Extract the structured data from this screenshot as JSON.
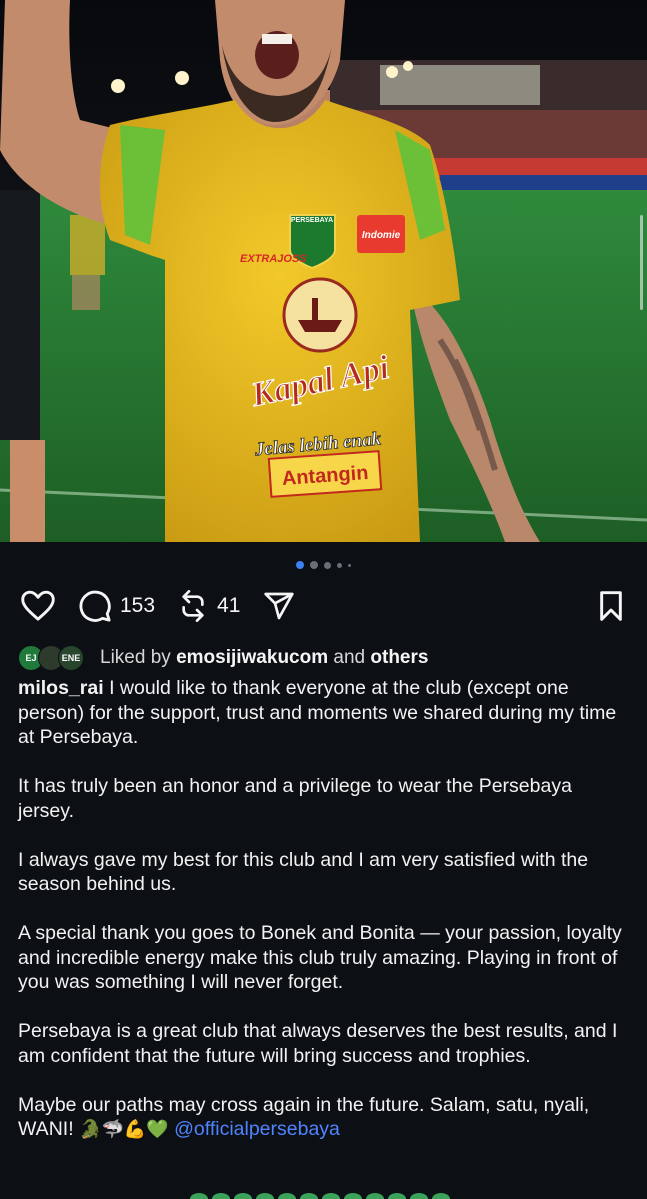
{
  "photo": {
    "alt": "Persebaya player celebrating",
    "jersey_texts": [
      "PERSEBAYA",
      "EXTRAJOSS",
      "Kapal Api",
      "Jelas lebih enak",
      "Antangin",
      "Indomie"
    ]
  },
  "carousel": {
    "count": 5,
    "active": 0
  },
  "actions": {
    "comments": "153",
    "reposts": "41"
  },
  "liked_by": {
    "prefix": "Liked by",
    "user": "emosijiwakucom",
    "joiner": "and",
    "others": "others",
    "avatars": [
      "EJ",
      "",
      "ENE"
    ]
  },
  "caption": {
    "username": "milos_rai",
    "p1": "I would like to thank everyone at the club (except one person) for the support, trust and moments we shared during my time at Persebaya.",
    "p2": "It has truly been an honor and a privilege to wear the Persebaya jersey.",
    "p3": "I always gave my best for this club and I am very satisfied with the season behind us.",
    "p4": "A special thank you goes to Bonek and Bonita — your passion, loyalty and incredible energy make this club truly amazing. Playing in front of you was something I will never forget.",
    "p5": "Persebaya is a great club that always deserves the best results, and I am confident that the future will bring success and trophies.",
    "p6": "Maybe our paths may cross again in the future.  Salam, satu, nyali, WANI!",
    "emojis": "🐊🦈💪💚",
    "mention": "@officialpersebaya"
  },
  "colors": {
    "background": "#0c1014",
    "accent": "#3b82f6",
    "mention": "#4f83ff",
    "jersey": "#e8bd1f"
  }
}
